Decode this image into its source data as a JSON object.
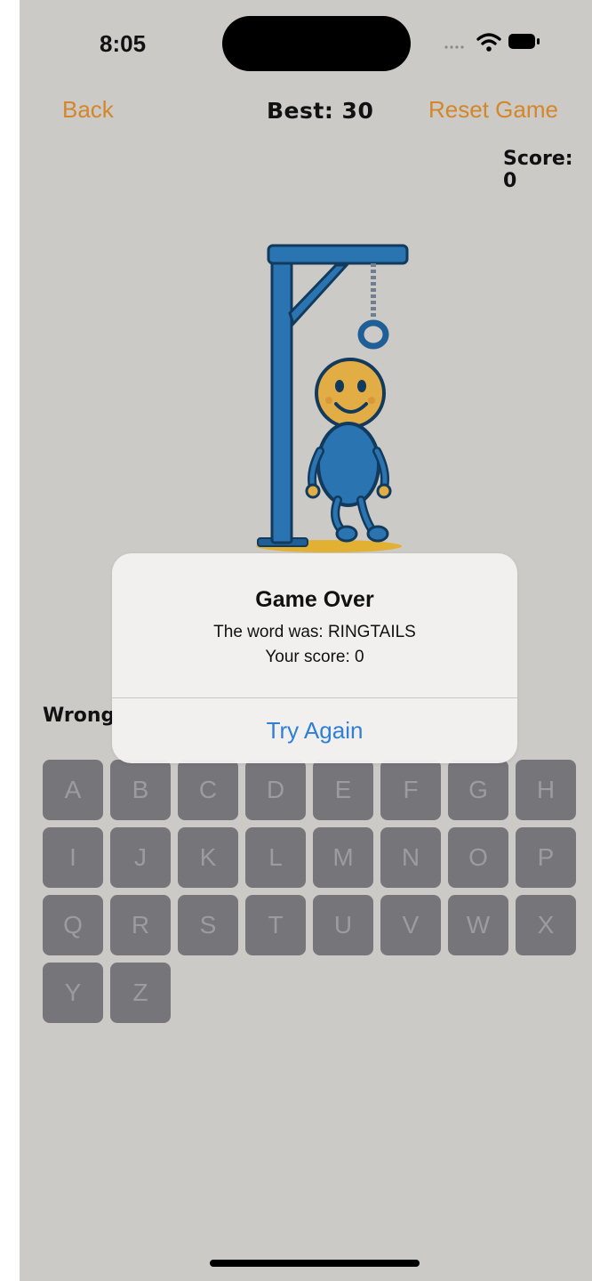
{
  "status_bar": {
    "time": "8:05",
    "icons": [
      "signal-icon",
      "wifi-icon",
      "battery-icon"
    ]
  },
  "nav": {
    "back_label": "Back",
    "best_label": "Best: 30",
    "reset_label": "Reset Game"
  },
  "score_label": "Score: 0",
  "wrong_label": "Wrong",
  "keyboard": {
    "rows": [
      [
        "A",
        "B",
        "C",
        "D",
        "E",
        "F",
        "G",
        "H"
      ],
      [
        "I",
        "J",
        "K",
        "L",
        "M",
        "N",
        "O",
        "P"
      ],
      [
        "Q",
        "R",
        "S",
        "T",
        "U",
        "V",
        "W",
        "X"
      ],
      [
        "Y",
        "Z"
      ]
    ]
  },
  "alert": {
    "title": "Game Over",
    "line1": "The word was: RINGTAILS",
    "line2": "Your score: 0",
    "button": "Try Again"
  },
  "colors": {
    "accent_orange": "#d4862a",
    "link_blue": "#2f7fd6",
    "background": "#cbcac6",
    "key_fill": "#76757a"
  }
}
